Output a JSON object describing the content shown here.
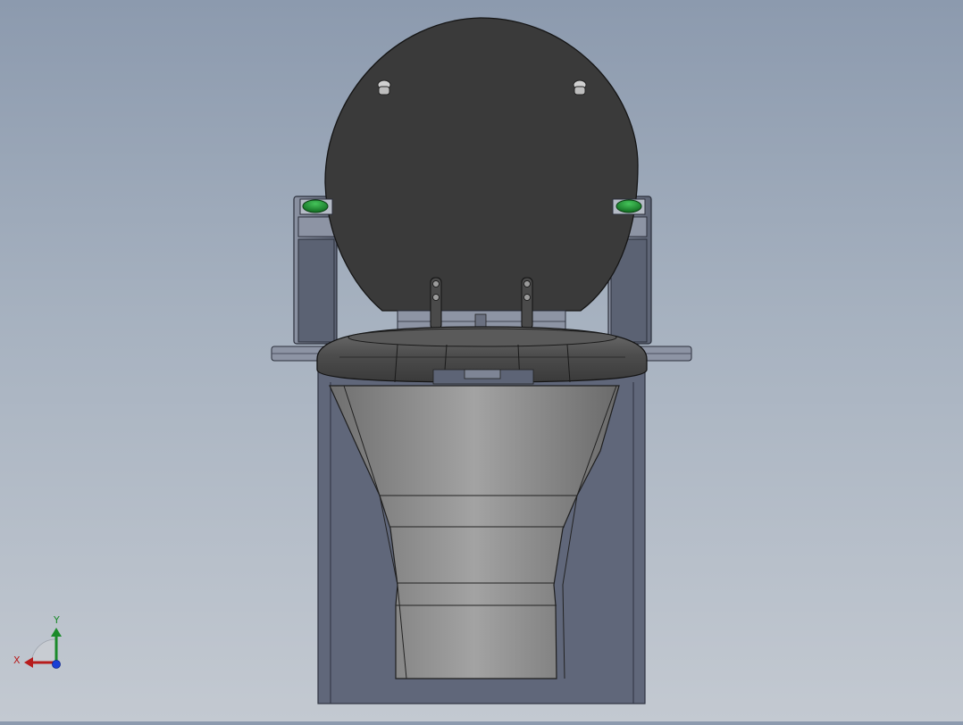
{
  "view": {
    "background_top": "#8c9aae",
    "background_bottom": "#c3c9d1"
  },
  "model": {
    "lid_color": "#3a3a3a",
    "indicator_color": "#1f8a2c",
    "bowl_color": "#8a8a8a",
    "cabinet_color": "#606779"
  },
  "triad": {
    "x_label": "X",
    "y_label": "Y",
    "x_color": "#b71c1c",
    "y_color": "#1b8a2a",
    "z_color": "#1a3fd6",
    "icons": [
      "x-axis-arrow-icon",
      "y-axis-arrow-icon",
      "z-axis-dot-icon"
    ]
  }
}
